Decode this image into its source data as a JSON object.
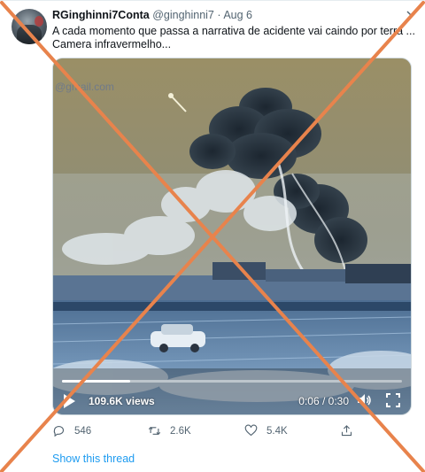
{
  "tweet": {
    "display_name": "RGinghinni7Conta",
    "handle": "@ginghinni7",
    "separator": "·",
    "date": "Aug 6",
    "text_lines": [
      "A cada momento que passa a narrativa de acidente vai caindo por terra ...",
      "Camera infravermelho..."
    ]
  },
  "video": {
    "watermark": "@gmail.com",
    "views": "109.6K views",
    "time": "0:06 / 0:30",
    "progress": 0.2
  },
  "actions": {
    "replies": "546",
    "retweets": "2.6K",
    "likes": "5.4K"
  },
  "show_thread": "Show this thread",
  "colors": {
    "accent": "#1d9bf0",
    "overlay_x": "#e8834c",
    "muted": "#536471"
  },
  "icons": {
    "reply": "reply-icon",
    "retweet": "retweet-icon",
    "like": "heart-icon",
    "share": "share-icon",
    "more": "caret-down-icon",
    "play": "play-icon",
    "volume": "volume-icon",
    "fullscreen": "fullscreen-icon"
  }
}
